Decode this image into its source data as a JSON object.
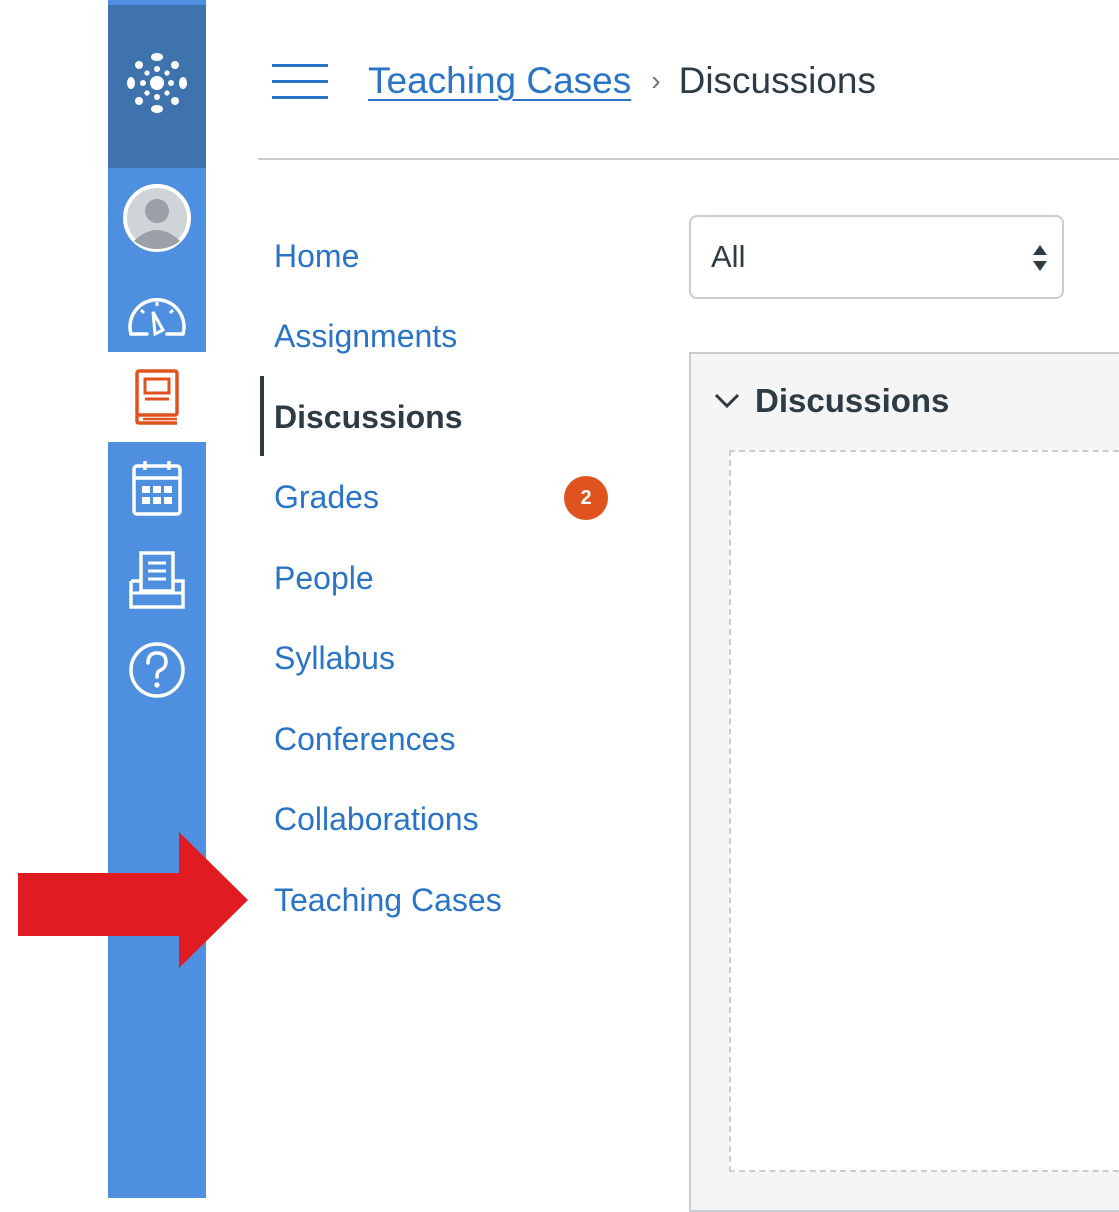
{
  "global_nav": {
    "items": [
      {
        "icon": "canvas-logo-icon"
      },
      {
        "icon": "account-avatar-icon"
      },
      {
        "icon": "dashboard-icon"
      },
      {
        "icon": "courses-icon"
      },
      {
        "icon": "calendar-icon"
      },
      {
        "icon": "inbox-icon"
      },
      {
        "icon": "help-icon"
      }
    ],
    "colors": {
      "nav_bg": "#4e8fdf",
      "logo_bg": "#3f73ad",
      "active_icon": "#e0531f"
    }
  },
  "header": {
    "menu_icon": "hamburger-icon",
    "breadcrumb": {
      "course": "Teaching Cases",
      "separator": "›",
      "current": "Discussions"
    }
  },
  "course_nav": {
    "items": [
      {
        "label": "Home"
      },
      {
        "label": "Assignments"
      },
      {
        "label": "Discussions",
        "active": true
      },
      {
        "label": "Grades",
        "badge": "2"
      },
      {
        "label": "People"
      },
      {
        "label": "Syllabus"
      },
      {
        "label": "Conferences"
      },
      {
        "label": "Collaborations"
      },
      {
        "label": "Teaching Cases"
      }
    ]
  },
  "filter": {
    "selected": "All"
  },
  "discussions_panel": {
    "title": "Discussions"
  },
  "annotation": {
    "arrow_color": "#e11b22",
    "icon": "red-arrow-icon"
  }
}
